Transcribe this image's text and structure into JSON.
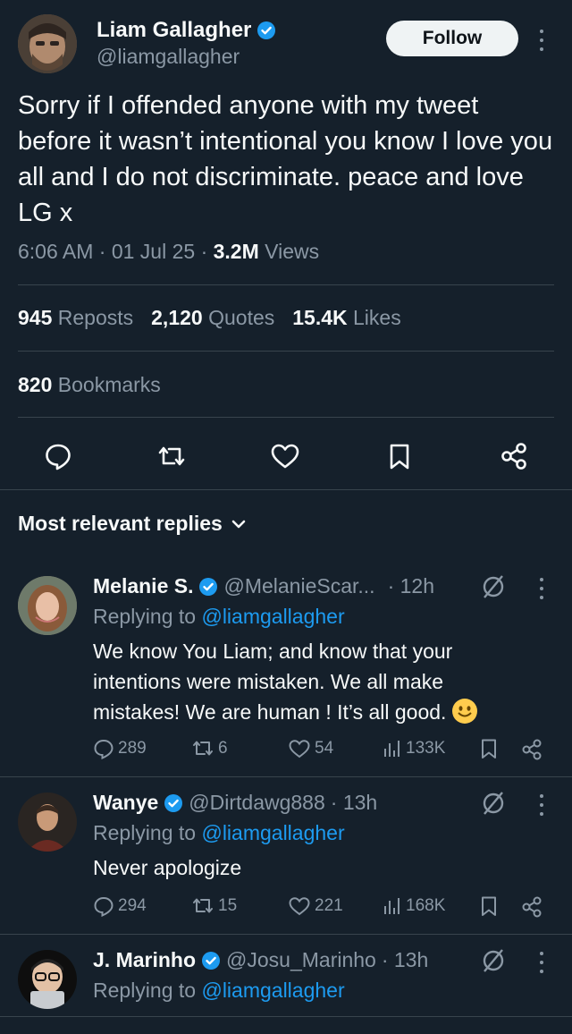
{
  "tweet": {
    "author_name": "Liam Gallagher",
    "author_handle": "@liamgallagher",
    "follow_label": "Follow",
    "text": "Sorry if I offended anyone with my tweet before it wasn’t intentional you know I love you all and I do not discriminate. peace and love LG x",
    "time": "6:06 AM · 01 Jul 25 · ",
    "views_count": "3.2M",
    "views_label": " Views",
    "reposts_count": "945",
    "reposts_label": " Reposts",
    "quotes_count": "2,120",
    "quotes_label": " Quotes",
    "likes_count": "15.4K",
    "likes_label": " Likes",
    "bookmarks_count": "820",
    "bookmarks_label": " Bookmarks"
  },
  "replies_header": "Most relevant replies",
  "replies": [
    {
      "name": "Melanie S.",
      "handle": "@MelanieScar...",
      "time": "· 12h",
      "replying_prefix": "Replying to ",
      "replying_to": "@liamgallagher",
      "text": "We know You Liam; and know that your intentions were mistaken. We all make mistakes! We are human ! It’s all good.",
      "replies": "289",
      "reposts": "6",
      "likes": "54",
      "views": "133K"
    },
    {
      "name": "Wanye",
      "handle": "@Dirtdawg888",
      "time": "· 13h",
      "replying_prefix": "Replying to ",
      "replying_to": "@liamgallagher",
      "text": "Never apologize",
      "replies": "294",
      "reposts": "15",
      "likes": "221",
      "views": "168K"
    },
    {
      "name": "J. Marinho",
      "handle": "@Josu_Marinho",
      "time": "· 13h",
      "replying_prefix": "Replying to ",
      "replying_to": "@liamgallagher"
    }
  ],
  "colors": {
    "background": "#15202b",
    "text": "#f7f9f9",
    "muted": "#8b98a5",
    "accent": "#1d9bf0",
    "divider": "#38444d"
  }
}
